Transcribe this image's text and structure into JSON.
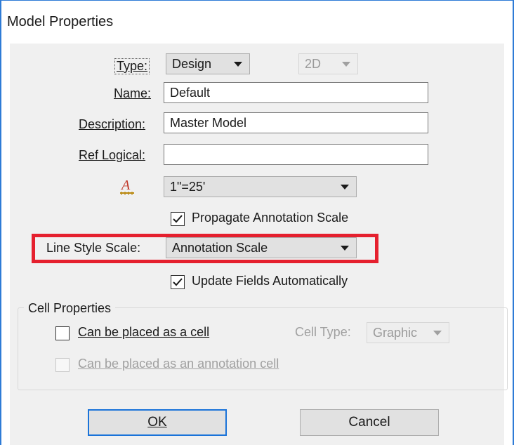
{
  "window": {
    "title": "Model Properties"
  },
  "form": {
    "type_label": "Type:",
    "type_value": "Design",
    "dimension_value": "2D",
    "name_label": "Name:",
    "name_value": "Default",
    "description_label": "Description:",
    "description_value": "Master Model",
    "ref_logical_label": "Ref Logical:",
    "ref_logical_value": "",
    "annotation_scale_icon": "annotation-scale-icon",
    "annotation_scale_value": "1\"=25'",
    "propagate_label": "Propagate Annotation Scale",
    "propagate_checked": true,
    "line_style_scale_label": "Line Style Scale:",
    "line_style_scale_value": "Annotation Scale",
    "update_fields_label": "Update Fields Automatically",
    "update_fields_checked": true
  },
  "cell_properties": {
    "group_title": "Cell Properties",
    "placed_as_cell_label": "Can be placed as a cell",
    "placed_as_cell_checked": false,
    "cell_type_label": "Cell Type:",
    "cell_type_value": "Graphic",
    "annotation_cell_label": "Can be placed as an annotation cell",
    "annotation_cell_checked": false
  },
  "buttons": {
    "ok": "OK",
    "cancel": "Cancel"
  },
  "colors": {
    "highlight": "#e5202e",
    "default_button_border": "#1a73d9",
    "dialog_background": "#f0f0f0",
    "window_edge": "#2e7bd6"
  }
}
